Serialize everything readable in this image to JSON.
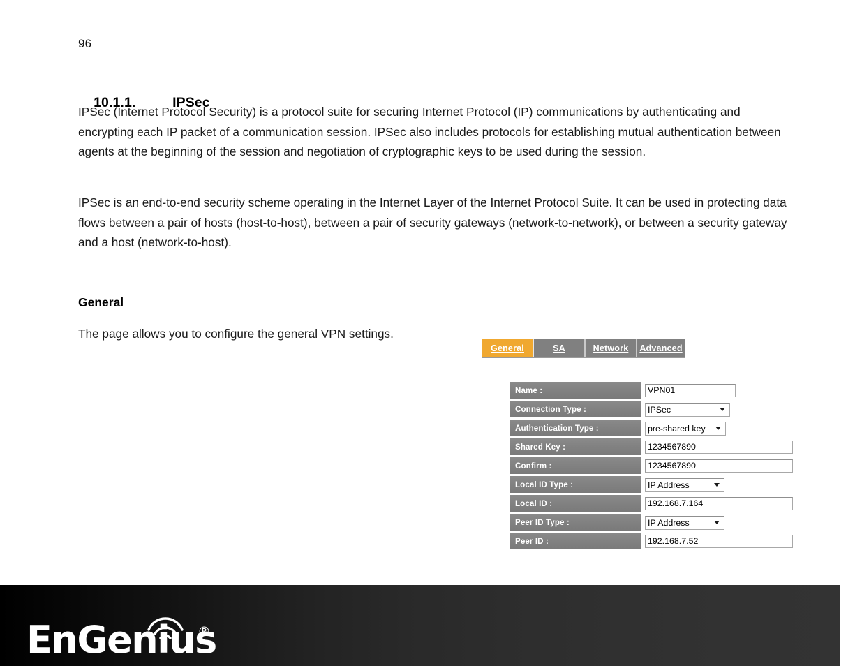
{
  "document": {
    "page_number": "96",
    "section_number": "10.1.1.",
    "section_title": "IPSec",
    "paragraph_1": "IPSec (Internet Protocol Security) is a protocol suite for securing Internet Protocol (IP) communications by authenticating and encrypting each IP packet of a communication session. IPSec also includes protocols for establishing mutual authentication between agents at the beginning of the session and negotiation of cryptographic keys to be used during the session.",
    "paragraph_2": "IPSec is an end-to-end security scheme operating in the Internet Layer of the Internet Protocol Suite. It can be used in protecting data flows between a pair of hosts (host-to-host), between a pair of security gateways (network-to-network), or between a security gateway and a host (network-to-host).",
    "subsection_title": "General",
    "subsection_intro": "The page allows you to configure the general VPN settings."
  },
  "ui_screenshot": {
    "tabs": [
      {
        "label": "General",
        "active": true
      },
      {
        "label": "SA",
        "active": false
      },
      {
        "label": "Network",
        "active": false
      },
      {
        "label": "Advanced",
        "active": false
      }
    ],
    "form_rows": [
      {
        "label": "Name :",
        "control": "text",
        "value": "VPN01"
      },
      {
        "label": "Connection Type :",
        "control": "select",
        "value": "IPSec"
      },
      {
        "label": "Authentication Type :",
        "control": "select",
        "value": "pre-shared key"
      },
      {
        "label": "Shared Key :",
        "control": "text",
        "value": "1234567890"
      },
      {
        "label": "Confirm :",
        "control": "text",
        "value": "1234567890"
      },
      {
        "label": "Local ID Type :",
        "control": "select",
        "value": "IP Address"
      },
      {
        "label": "Local ID :",
        "control": "text",
        "value": "192.168.7.164"
      },
      {
        "label": "Peer ID Type :",
        "control": "select",
        "value": "IP Address"
      },
      {
        "label": "Peer ID :",
        "control": "text",
        "value": "192.168.7.52"
      }
    ],
    "colors": {
      "active_tab": "#f0a830",
      "tab_bar": "#808080",
      "label_cell": "#818181",
      "label_text": "#ffffff"
    }
  },
  "footer": {
    "brand": "EnGenius",
    "trademark": "®",
    "wifi_icon": "wifi-arcs-icon"
  }
}
